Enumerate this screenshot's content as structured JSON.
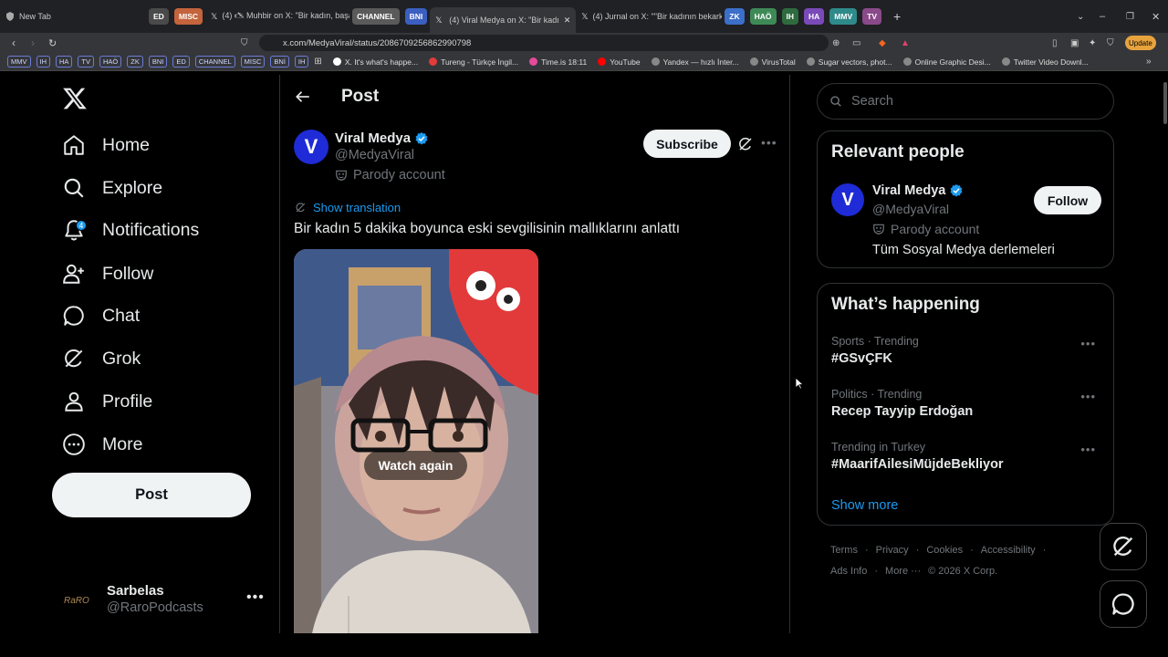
{
  "browser": {
    "tabs": [
      {
        "label": "New Tab"
      },
      {
        "label": "(4) 🖎 Muhbir on X: \"Bir kadın, başarı"
      },
      {
        "label": "(4) Viral Medya on X: \"Bir kadın 5"
      },
      {
        "label": "(4) Jurnal on X: \"\"Bir kadının bekarken"
      }
    ],
    "groups_a": [
      {
        "label": "ED",
        "color": "#4a4a4a"
      },
      {
        "label": "MISC",
        "color": "#c4643c"
      }
    ],
    "groups_b": [
      {
        "label": "CHANNEL",
        "color": "#5a5a5a"
      },
      {
        "label": "BNI",
        "color": "#3b5fc0"
      }
    ],
    "groups_c": [
      {
        "label": "ZK",
        "color": "#3b6fc9"
      },
      {
        "label": "HAÖ",
        "color": "#3e8a57"
      },
      {
        "label": "IH",
        "color": "#2f6b3f"
      },
      {
        "label": "HA",
        "color": "#7a4ab8"
      },
      {
        "label": "MMV",
        "color": "#2f8a8a"
      },
      {
        "label": "TV",
        "color": "#8a4a8a"
      }
    ],
    "url": "x.com/MedyaViral/status/2086709256862990798",
    "update_label": "Update",
    "bookmark_chips": [
      "MMV",
      "IH",
      "HA",
      "TV",
      "HAÖ",
      "ZK",
      "BNI",
      "ED",
      "CHANNEL",
      "MISC",
      "BNİ",
      "IH"
    ],
    "bookmarks": [
      {
        "label": "X. It's what's happe...",
        "color": "#ffffff"
      },
      {
        "label": "Tureng - Türkçe İngil...",
        "color": "#e23b3b"
      },
      {
        "label": "Time.is 18:11",
        "color": "#e64a9a"
      },
      {
        "label": "YouTube",
        "color": "#ff0000"
      },
      {
        "label": "Yandex — hızlı İnter...",
        "color": "#cccccc"
      },
      {
        "label": "VirusTotal",
        "color": "#cccccc"
      },
      {
        "label": "Sugar vectors, phot...",
        "color": "#cccccc"
      },
      {
        "label": "Online Graphic Desi...",
        "color": "#cccccc"
      },
      {
        "label": "Twitter Video Downl...",
        "color": "#cccccc"
      }
    ]
  },
  "nav": {
    "items": [
      {
        "label": "Home",
        "icon": "home-icon"
      },
      {
        "label": "Explore",
        "icon": "search-icon"
      },
      {
        "label": "Notifications",
        "icon": "bell-icon",
        "badge": "4"
      },
      {
        "label": "Follow",
        "icon": "follow-icon"
      },
      {
        "label": "Chat",
        "icon": "chat-icon"
      },
      {
        "label": "Grok",
        "icon": "grok-icon"
      },
      {
        "label": "Profile",
        "icon": "profile-icon"
      },
      {
        "label": "More",
        "icon": "more-icon"
      }
    ],
    "post_label": "Post"
  },
  "account": {
    "name": "Sarbelas",
    "handle": "@RaroPodcasts",
    "logo_text": "RaRO"
  },
  "post": {
    "page_title": "Post",
    "avatar_letter": "V",
    "author": "Viral Medya",
    "handle": "@MedyaViral",
    "parody_label": "Parody account",
    "subscribe_label": "Subscribe",
    "show_translation": "Show translation",
    "text": "Bir kadın 5 dakika boyunca eski sevgilisinin mallıklarını anlattı",
    "watch_again": "Watch again"
  },
  "sidebar": {
    "search_placeholder": "Search",
    "relevant": {
      "title": "Relevant people",
      "avatar_letter": "V",
      "name": "Viral Medya",
      "handle": "@MedyaViral",
      "parody_label": "Parody account",
      "bio": "Tüm Sosyal Medya derlemeleri",
      "follow_label": "Follow"
    },
    "happening": {
      "title": "What’s happening",
      "trends": [
        {
          "category": "Sports · Trending",
          "title": "#GSvÇFK"
        },
        {
          "category": "Politics · Trending",
          "title": "Recep Tayyip Erdoğan"
        },
        {
          "category": "Trending in Turkey",
          "title": "#MaarifAilesiMüjdeBekliyor"
        }
      ],
      "show_more": "Show more"
    },
    "footer_row1": [
      "Terms",
      "·",
      "Privacy",
      "·",
      "Cookies",
      "·",
      "Accessibility",
      "·"
    ],
    "footer_row2": [
      "Ads Info",
      "·",
      "More ···",
      "© 2026 X Corp."
    ]
  },
  "colors": {
    "accent": "#1d9bf0",
    "avatar": "#1f2bd6"
  }
}
